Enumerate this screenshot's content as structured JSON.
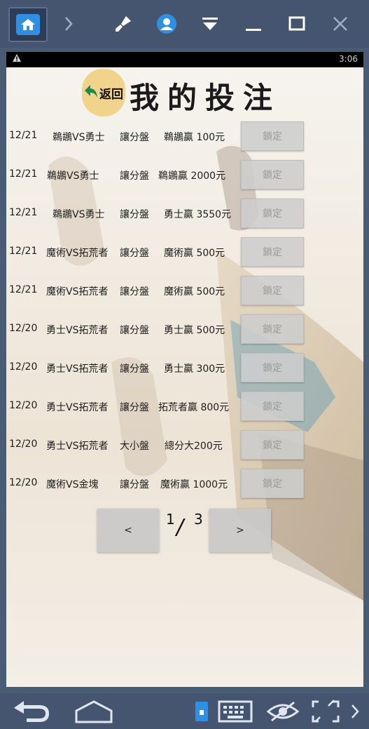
{
  "status": {
    "time": "3:06",
    "warning_icon": "warning-icon"
  },
  "header": {
    "back_label": "返回",
    "title": "我的投注"
  },
  "bets": [
    {
      "date": "12/21",
      "match": "鵜鶘VS勇士",
      "type": "讓分盤",
      "pick": "鵜鶘贏 100元",
      "action": "鎖定"
    },
    {
      "date": "12/21",
      "match": "鵜鶘VS勇士",
      "type": "讓分盤",
      "pick": "鵜鶘贏 2000元",
      "action": "鎖定"
    },
    {
      "date": "12/21",
      "match": "鵜鶘VS勇士",
      "type": "讓分盤",
      "pick": "勇士贏 3550元",
      "action": "鎖定"
    },
    {
      "date": "12/21",
      "match": "魔術VS拓荒者",
      "type": "讓分盤",
      "pick": "魔術贏 500元",
      "action": "鎖定"
    },
    {
      "date": "12/21",
      "match": "魔術VS拓荒者",
      "type": "讓分盤",
      "pick": "魔術贏 500元",
      "action": "鎖定"
    },
    {
      "date": "12/20",
      "match": "勇士VS拓荒者",
      "type": "讓分盤",
      "pick": "勇士贏 500元",
      "action": "鎖定"
    },
    {
      "date": "12/20",
      "match": "勇士VS拓荒者",
      "type": "讓分盤",
      "pick": "勇士贏 300元",
      "action": "鎖定"
    },
    {
      "date": "12/20",
      "match": "勇士VS拓荒者",
      "type": "讓分盤",
      "pick": "拓荒者贏 800元",
      "action": "鎖定"
    },
    {
      "date": "12/20",
      "match": "勇士VS拓荒者",
      "type": "大小盤",
      "pick": "總分大200元",
      "action": "鎖定"
    },
    {
      "date": "12/20",
      "match": "魔術VS金塊",
      "type": "讓分盤",
      "pick": "魔術贏 1000元",
      "action": "鎖定"
    }
  ],
  "pager": {
    "prev": "<",
    "next": ">",
    "current": "1",
    "separator": "/",
    "total": "3"
  },
  "colors": {
    "toolbar": "#46556f",
    "accent": "#2f8fe3",
    "back_button": "#f2d38c"
  }
}
